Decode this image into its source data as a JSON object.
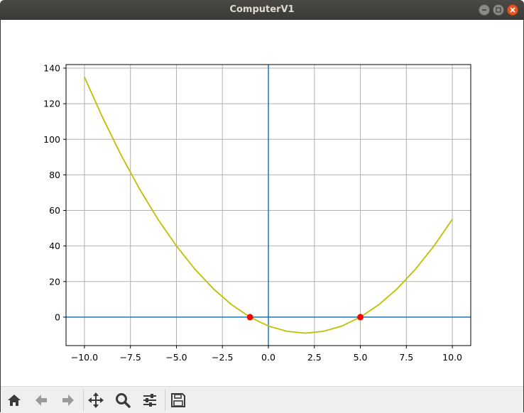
{
  "window": {
    "title": "ComputerV1"
  },
  "toolbar": {
    "buttons": [
      {
        "name": "home-button",
        "icon": "home-icon"
      },
      {
        "name": "back-button",
        "icon": "arrow-left-icon"
      },
      {
        "name": "forward-button",
        "icon": "arrow-right-icon"
      },
      {
        "name": "pan-button",
        "icon": "move-icon"
      },
      {
        "name": "zoom-button",
        "icon": "magnifier-icon"
      },
      {
        "name": "configure-subplots-button",
        "icon": "sliders-icon"
      },
      {
        "name": "save-button",
        "icon": "floppy-disk-icon"
      }
    ]
  },
  "chart_data": {
    "type": "line",
    "title": "",
    "xlabel": "",
    "ylabel": "",
    "xlim": [
      -11,
      11
    ],
    "ylim": [
      -16,
      142
    ],
    "xticks": [
      -10.0,
      -7.5,
      -5.0,
      -2.5,
      0.0,
      2.5,
      5.0,
      7.5,
      10.0
    ],
    "xtick_labels": [
      "−10.0",
      "−7.5",
      "−5.0",
      "−2.5",
      "0.0",
      "2.5",
      "5.0",
      "7.5",
      "10.0"
    ],
    "yticks": [
      0,
      20,
      40,
      60,
      80,
      100,
      120,
      140
    ],
    "ytick_labels": [
      "0",
      "20",
      "40",
      "60",
      "80",
      "100",
      "120",
      "140"
    ],
    "grid": true,
    "series": [
      {
        "type": "line",
        "color": "#bfbf00",
        "x": [
          -10,
          -9,
          -8,
          -7,
          -6,
          -5,
          -4,
          -3,
          -2,
          -1,
          0,
          1,
          2,
          3,
          4,
          5,
          6,
          7,
          8,
          9,
          10
        ],
        "y": [
          135,
          112,
          91,
          72,
          55,
          40,
          27,
          16,
          7,
          0,
          -5,
          -8,
          -9,
          -8,
          -5,
          0,
          7,
          16,
          27,
          40,
          55
        ]
      },
      {
        "type": "scatter",
        "color": "#ff0000",
        "x": [
          -1,
          5
        ],
        "y": [
          0,
          0
        ]
      }
    ],
    "axis_lines": [
      {
        "orientation": "horizontal",
        "value": 0,
        "color": "#1f77b4"
      },
      {
        "orientation": "vertical",
        "value": 0,
        "color": "#1f77b4"
      }
    ]
  }
}
